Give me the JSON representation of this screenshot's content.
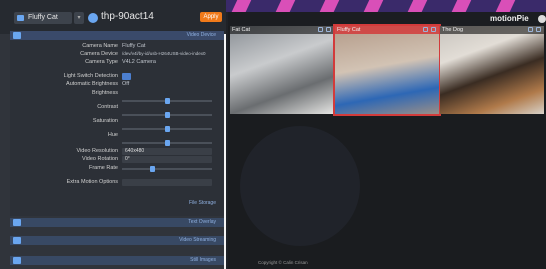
{
  "topbar": {
    "camera_select": "Fluffy Cat",
    "address": "thp-90act14",
    "apply_label": "Apply"
  },
  "brand": {
    "name": "motionPie"
  },
  "sections": {
    "video_device": "Video Device",
    "file_storage": "File Storage",
    "text_overlay": "Text Overlay",
    "video_streaming": "Video Streaming",
    "still_images": "Still Images"
  },
  "fields": {
    "camera_name": {
      "label": "Camera Name",
      "value": "Fluffy Cat"
    },
    "camera_device": {
      "label": "Camera Device",
      "value": "/dev/v4l/by-id/usb-H264USB-video-index0"
    },
    "camera_type": {
      "label": "Camera Type",
      "value": "V4L2 Camera"
    },
    "light_switch": {
      "label": "Light Switch Detection"
    },
    "auto_brightness": {
      "label": "Automatic Brightness",
      "value": "Off"
    },
    "brightness": {
      "label": "Brightness",
      "value": 0.5
    },
    "contrast": {
      "label": "Contrast",
      "value": 0.5
    },
    "saturation": {
      "label": "Saturation",
      "value": 0.5
    },
    "hue": {
      "label": "Hue",
      "value": 0.5
    },
    "video_resolution": {
      "label": "Video Resolution",
      "value": "640x480"
    },
    "video_rotation": {
      "label": "Video Rotation",
      "value": "0°"
    },
    "frame_rate": {
      "label": "Frame Rate",
      "value": 0.33
    },
    "extra_motion": {
      "label": "Extra Motion Options",
      "value": ""
    }
  },
  "cameras": [
    {
      "name": "Fat Cat"
    },
    {
      "name": "Fluffy Cat"
    },
    {
      "name": "The Dog"
    }
  ],
  "footer": {
    "copyright": "Copyright © Calin Crisan"
  },
  "colors": {
    "accent": "#6aa6f0",
    "apply": "#f07a1a",
    "selected": "#d23b3b"
  }
}
